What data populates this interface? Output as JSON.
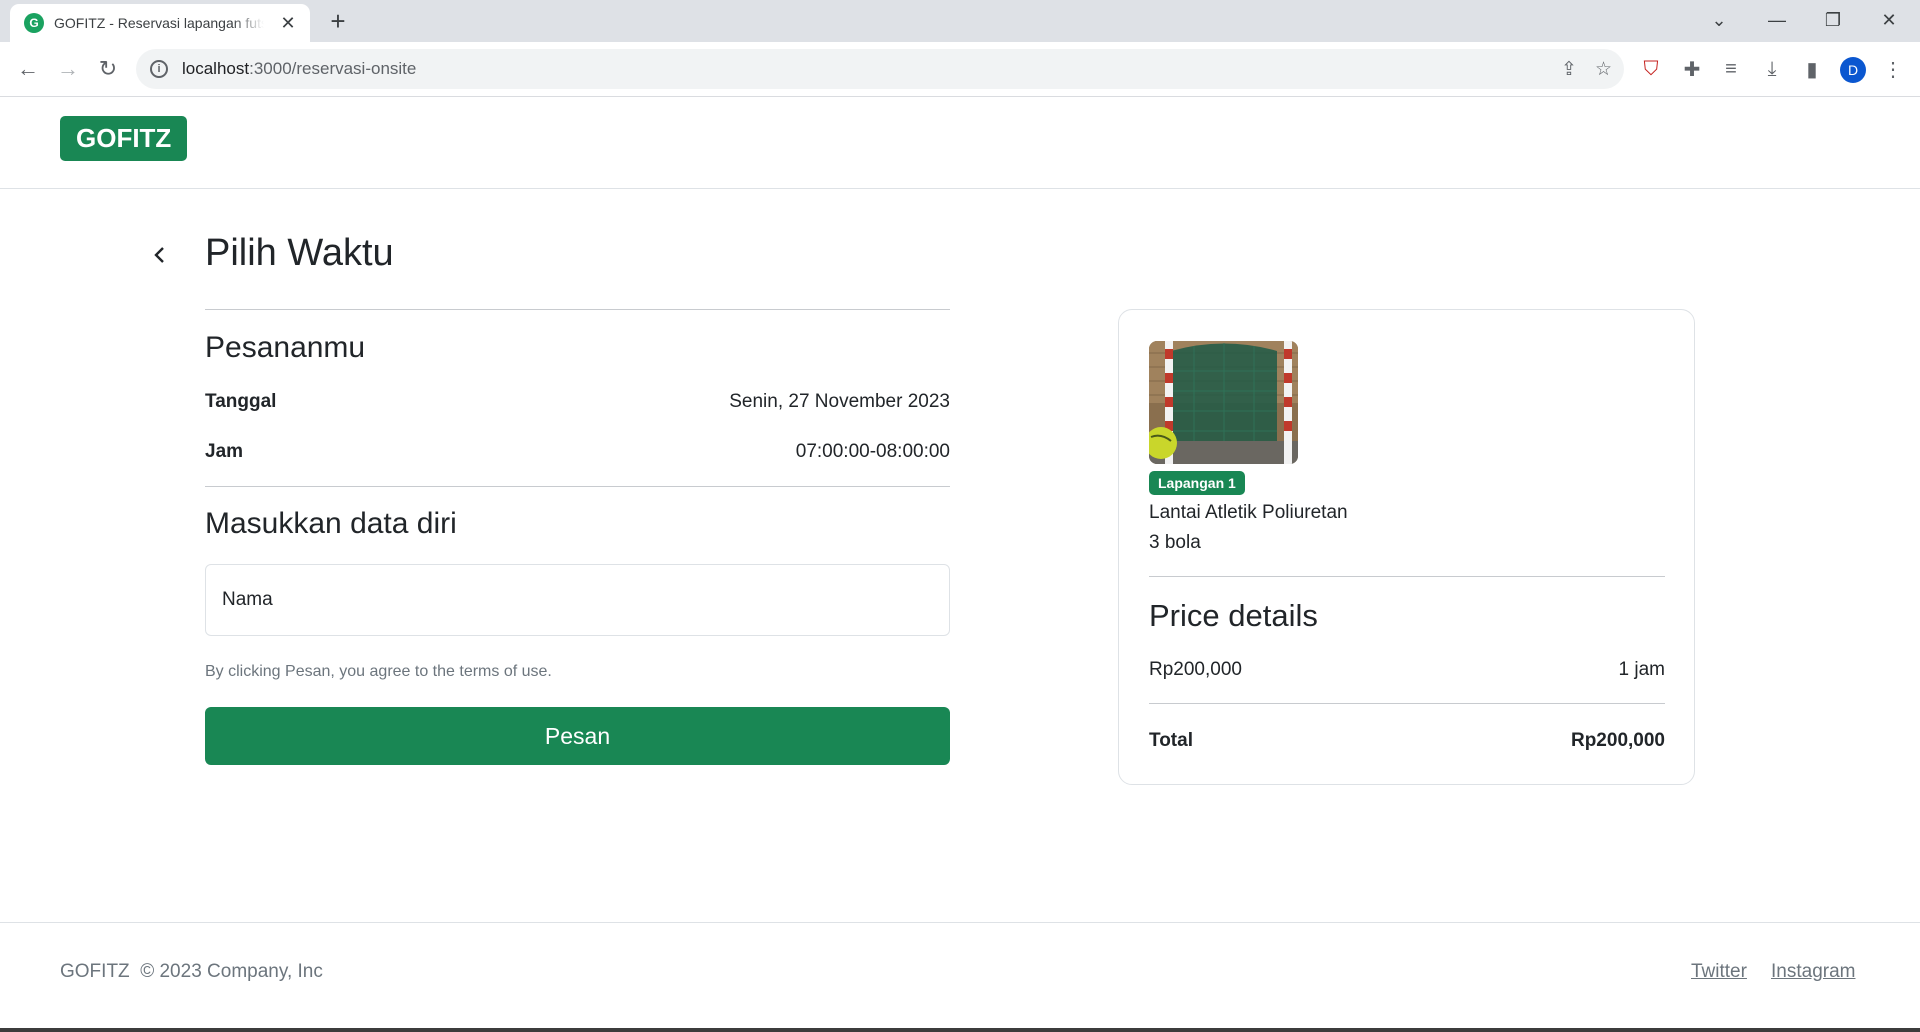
{
  "browser": {
    "tab_title": "GOFITZ - Reservasi lapangan futsal",
    "favicon_letter": "G",
    "url_host": "localhost",
    "url_path": ":3000/reservasi-onsite",
    "profile_initial": "D"
  },
  "header": {
    "logo": "GOFITZ"
  },
  "page": {
    "title": "Pilih Waktu"
  },
  "order": {
    "section_title": "Pesananmu",
    "rows": [
      {
        "label": "Tanggal",
        "value": "Senin, 27 November 2023"
      },
      {
        "label": "Jam",
        "value": "07:00:00-08:00:00"
      }
    ]
  },
  "form": {
    "section_title": "Masukkan data diri",
    "name_placeholder": "Nama",
    "terms": "By clicking Pesan, you agree to the terms of use.",
    "submit_label": "Pesan"
  },
  "summary": {
    "badge": "Lapangan 1",
    "floor": "Lantai Atletik Poliuretan",
    "balls": "3 bola",
    "price_title": "Price details",
    "price": "Rp200,000",
    "duration": "1 jam",
    "total_label": "Total",
    "total_value": "Rp200,000"
  },
  "footer": {
    "brand": "GOFITZ  © 2023 Company, Inc",
    "links": [
      "Twitter",
      "Instagram"
    ]
  },
  "colors": {
    "brand": "#198754"
  },
  "icons": [
    "back-arrow-icon",
    "forward-arrow-icon",
    "reload-icon",
    "info-icon",
    "share-icon",
    "star-icon",
    "extensions-icon",
    "download-icon"
  ]
}
